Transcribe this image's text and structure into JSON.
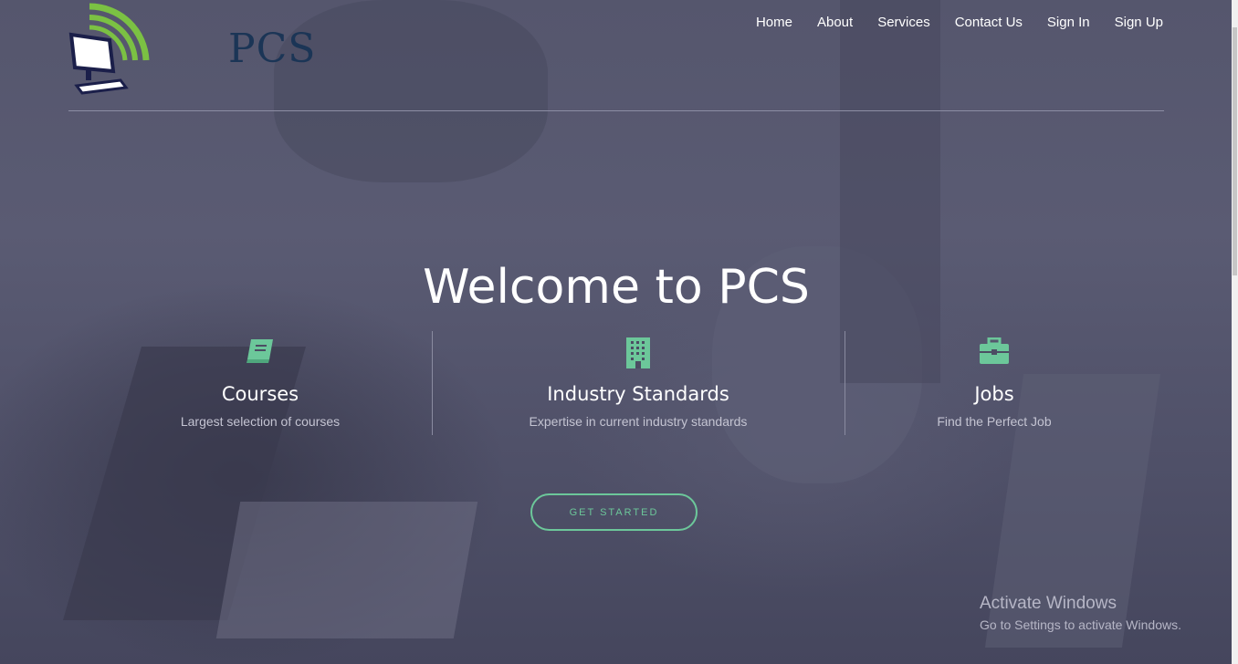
{
  "brand": {
    "name": "PCS"
  },
  "nav": [
    {
      "label": "Home"
    },
    {
      "label": "About"
    },
    {
      "label": "Services"
    },
    {
      "label": "Contact Us"
    },
    {
      "label": "Sign In"
    },
    {
      "label": "Sign Up"
    }
  ],
  "hero": {
    "title": "Welcome to PCS",
    "cta_label": "GET STARTED"
  },
  "features": [
    {
      "icon": "book-icon",
      "title": "Courses",
      "subtitle": "Largest selection of courses"
    },
    {
      "icon": "building-icon",
      "title": "Industry Standards",
      "subtitle": "Expertise in current industry standards"
    },
    {
      "icon": "briefcase-icon",
      "title": "Jobs",
      "subtitle": "Find the Perfect Job"
    }
  ],
  "watermark": {
    "title": "Activate Windows",
    "subtitle": "Go to Settings to activate Windows."
  },
  "colors": {
    "accent": "#6cc79a",
    "logo_green": "#7bc143",
    "logo_navy": "#1b3556",
    "overlay": "#4c4d63"
  }
}
